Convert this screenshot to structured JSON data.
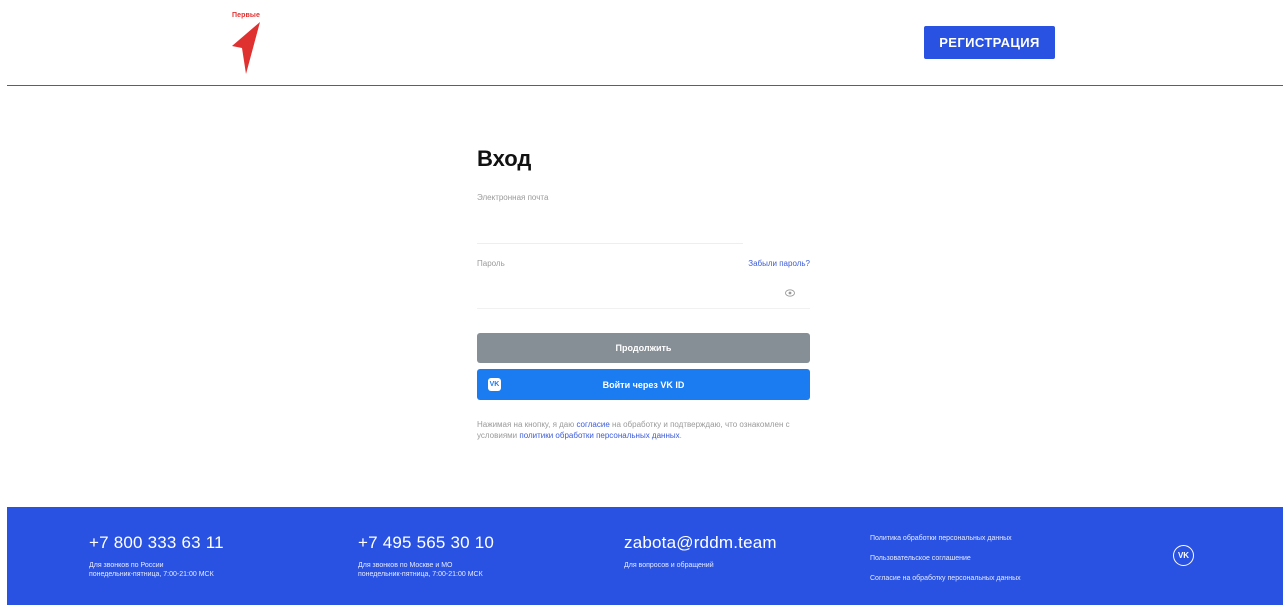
{
  "header": {
    "logo_text": "Первые",
    "register_label": "РЕГИСТРАЦИЯ"
  },
  "form": {
    "title": "Вход",
    "email_label": "Электронная почта",
    "password_label": "Пароль",
    "forgot_label": "Забыли пароль?",
    "continue_label": "Продолжить",
    "vk_label": "Войти через VK ID",
    "vk_badge": "VK",
    "consent": {
      "part1": "Нажимая на кнопку, я даю ",
      "link1": "согласие",
      "part2": " на обработку и подтверждаю, что ознакомлен с условиями ",
      "link2": "политики обработки персональных данных",
      "part3": "."
    }
  },
  "footer": {
    "contact1": {
      "phone": "+7 800 333 63 11",
      "line1": "Для звонков по России",
      "line2": "понедельник-пятница, 7:00-21:00 МСК"
    },
    "contact2": {
      "phone": "+7 495 565 30 10",
      "line1": "Для звонков по Москве и МО",
      "line2": "понедельник-пятница, 7:00-21:00 МСК"
    },
    "contact3": {
      "email": "zabota@rddm.team",
      "line1": "Для вопросов и обращений"
    },
    "links": [
      "Политика обработки персональных данных",
      "Пользовательское соглашение",
      "Согласие на обработку персональных данных"
    ],
    "social_icon": "vk-icon"
  },
  "colors": {
    "primary": "#2952e3",
    "vk": "#1a7cf0",
    "disabled": "#868e96",
    "link": "#3b5bdb",
    "logo_red": "#e03131"
  }
}
